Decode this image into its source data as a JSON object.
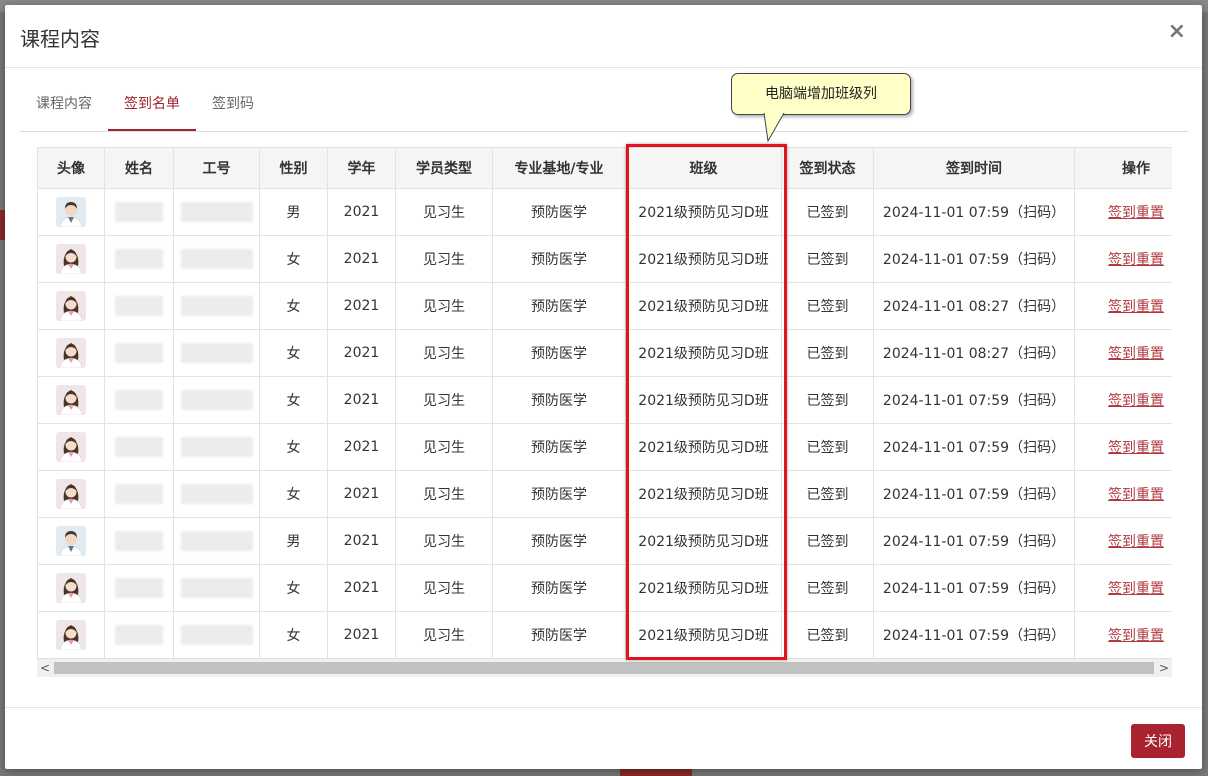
{
  "modal": {
    "title": "课程内容",
    "close_icon": "×",
    "close_button_label": "关闭"
  },
  "tabs": [
    {
      "label": "课程内容",
      "active": false
    },
    {
      "label": "签到名单",
      "active": true
    },
    {
      "label": "签到码",
      "active": false
    }
  ],
  "annotation": {
    "callout_text": "电脑端增加班级列",
    "highlight_color": "#e0141e"
  },
  "colors": {
    "accent": "#a0232e",
    "link": "#b03a40"
  },
  "table": {
    "columns": [
      "头像",
      "姓名",
      "工号",
      "性别",
      "学年",
      "学员类型",
      "专业基地/专业",
      "班级",
      "签到状态",
      "签到时间",
      "操作"
    ],
    "rows": [
      {
        "avatar": "male-doctor-icon",
        "gender": "男",
        "year": "2021",
        "type": "见习生",
        "major": "预防医学",
        "class": "2021级预防见习D班",
        "status": "已签到",
        "time": "2024-11-01 07:59（扫码）",
        "action": "签到重置"
      },
      {
        "avatar": "female-doctor-icon",
        "gender": "女",
        "year": "2021",
        "type": "见习生",
        "major": "预防医学",
        "class": "2021级预防见习D班",
        "status": "已签到",
        "time": "2024-11-01 07:59（扫码）",
        "action": "签到重置"
      },
      {
        "avatar": "female-doctor-icon",
        "gender": "女",
        "year": "2021",
        "type": "见习生",
        "major": "预防医学",
        "class": "2021级预防见习D班",
        "status": "已签到",
        "time": "2024-11-01 08:27（扫码）",
        "action": "签到重置"
      },
      {
        "avatar": "female-doctor-icon",
        "gender": "女",
        "year": "2021",
        "type": "见习生",
        "major": "预防医学",
        "class": "2021级预防见习D班",
        "status": "已签到",
        "time": "2024-11-01 08:27（扫码）",
        "action": "签到重置"
      },
      {
        "avatar": "female-doctor-icon",
        "gender": "女",
        "year": "2021",
        "type": "见习生",
        "major": "预防医学",
        "class": "2021级预防见习D班",
        "status": "已签到",
        "time": "2024-11-01 07:59（扫码）",
        "action": "签到重置"
      },
      {
        "avatar": "female-doctor-icon",
        "gender": "女",
        "year": "2021",
        "type": "见习生",
        "major": "预防医学",
        "class": "2021级预防见习D班",
        "status": "已签到",
        "time": "2024-11-01 07:59（扫码）",
        "action": "签到重置"
      },
      {
        "avatar": "female-doctor-icon",
        "gender": "女",
        "year": "2021",
        "type": "见习生",
        "major": "预防医学",
        "class": "2021级预防见习D班",
        "status": "已签到",
        "time": "2024-11-01 07:59（扫码）",
        "action": "签到重置"
      },
      {
        "avatar": "male-doctor-icon",
        "gender": "男",
        "year": "2021",
        "type": "见习生",
        "major": "预防医学",
        "class": "2021级预防见习D班",
        "status": "已签到",
        "time": "2024-11-01 07:59（扫码）",
        "action": "签到重置"
      },
      {
        "avatar": "female-doctor-icon",
        "gender": "女",
        "year": "2021",
        "type": "见习生",
        "major": "预防医学",
        "class": "2021级预防见习D班",
        "status": "已签到",
        "time": "2024-11-01 07:59（扫码）",
        "action": "签到重置"
      },
      {
        "avatar": "female-doctor-icon",
        "gender": "女",
        "year": "2021",
        "type": "见习生",
        "major": "预防医学",
        "class": "2021级预防见习D班",
        "status": "已签到",
        "time": "2024-11-01 07:59（扫码）",
        "action": "签到重置"
      }
    ]
  },
  "scrollbar": {
    "left_arrow": "<",
    "right_arrow": ">"
  }
}
